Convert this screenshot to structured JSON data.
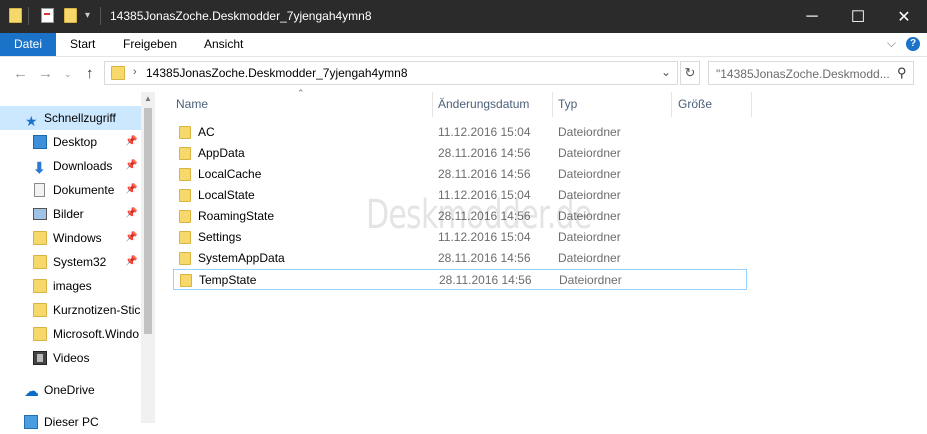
{
  "window": {
    "title": "14385JonasZoche.Deskmodder_7yjengah4ymn8",
    "minimize_glyph": "─",
    "maximize_glyph": "☐",
    "close_glyph": "✕"
  },
  "ribbon": {
    "tabs": [
      {
        "label": "Datei",
        "active": true
      },
      {
        "label": "Start"
      },
      {
        "label": "Freigeben"
      },
      {
        "label": "Ansicht"
      }
    ],
    "expand_glyph": "⌵",
    "help_glyph": "?"
  },
  "address": {
    "path": "14385JonasZoche.Deskmodder_7yjengah4ymn8",
    "search_placeholder": "\"14385JonasZoche.Deskmodd..."
  },
  "sidebar": {
    "items": [
      {
        "label": "Schnellzugriff",
        "icon": "star-icon",
        "selected": true,
        "pinned": false
      },
      {
        "label": "Desktop",
        "icon": "desktop-icon",
        "pinned": true
      },
      {
        "label": "Downloads",
        "icon": "download-icon",
        "pinned": true
      },
      {
        "label": "Dokumente",
        "icon": "document-icon",
        "pinned": true
      },
      {
        "label": "Bilder",
        "icon": "pictures-icon",
        "pinned": true
      },
      {
        "label": "Windows",
        "icon": "folder-icon",
        "pinned": true
      },
      {
        "label": "System32",
        "icon": "folder-icon",
        "pinned": true
      },
      {
        "label": "images",
        "icon": "folder-icon",
        "pinned": false
      },
      {
        "label": "Kurznotizen-Stic",
        "icon": "folder-icon",
        "pinned": false
      },
      {
        "label": "Microsoft.Windo",
        "icon": "folder-icon",
        "pinned": false
      },
      {
        "label": "Videos",
        "icon": "video-icon",
        "pinned": false
      },
      {
        "label": "OneDrive",
        "icon": "cloud-icon",
        "pinned": false
      },
      {
        "label": "Dieser PC",
        "icon": "computer-icon",
        "pinned": false
      }
    ],
    "pin_glyph": "📌"
  },
  "columns": {
    "name": "Name",
    "date": "Änderungsdatum",
    "type": "Typ",
    "size": "Größe"
  },
  "files": [
    {
      "name": "AC",
      "date": "11.12.2016 15:04",
      "type": "Dateiordner"
    },
    {
      "name": "AppData",
      "date": "28.11.2016 14:56",
      "type": "Dateiordner"
    },
    {
      "name": "LocalCache",
      "date": "28.11.2016 14:56",
      "type": "Dateiordner"
    },
    {
      "name": "LocalState",
      "date": "11.12.2016 15:04",
      "type": "Dateiordner"
    },
    {
      "name": "RoamingState",
      "date": "28.11.2016 14:56",
      "type": "Dateiordner"
    },
    {
      "name": "Settings",
      "date": "11.12.2016 15:04",
      "type": "Dateiordner"
    },
    {
      "name": "SystemAppData",
      "date": "28.11.2016 14:56",
      "type": "Dateiordner"
    },
    {
      "name": "TempState",
      "date": "28.11.2016 14:56",
      "type": "Dateiordner",
      "selected": true
    }
  ],
  "watermark": "Deskmodder.de",
  "colors": {
    "accent": "#1a73c9",
    "titlebar": "#2b2b2b",
    "selection": "#cce8ff",
    "folder": "#f7d86b"
  }
}
